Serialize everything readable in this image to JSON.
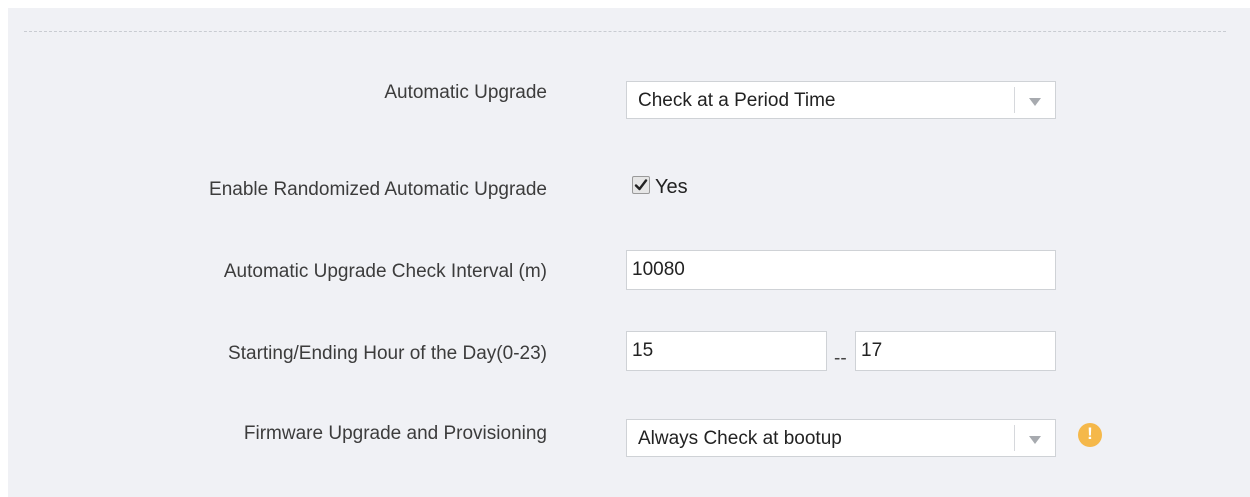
{
  "rows": {
    "automatic_upgrade": {
      "label": "Automatic Upgrade",
      "selected": "Check at a Period Time"
    },
    "randomized": {
      "label": "Enable Randomized Automatic Upgrade",
      "checked": true,
      "option_label": "Yes"
    },
    "interval": {
      "label": "Automatic Upgrade Check Interval (m)",
      "value": "10080"
    },
    "hours": {
      "label": "Starting/Ending Hour of the Day(0-23)",
      "start": "15",
      "separator": "--",
      "end": "17"
    },
    "firmware": {
      "label": "Firmware Upgrade and Provisioning",
      "selected": "Always Check at bootup",
      "warning_icon": "exclamation-circle-icon",
      "warning_glyph": "!"
    }
  },
  "colors": {
    "panel_bg": "#f0f1f5",
    "warning": "#f5b84a"
  }
}
